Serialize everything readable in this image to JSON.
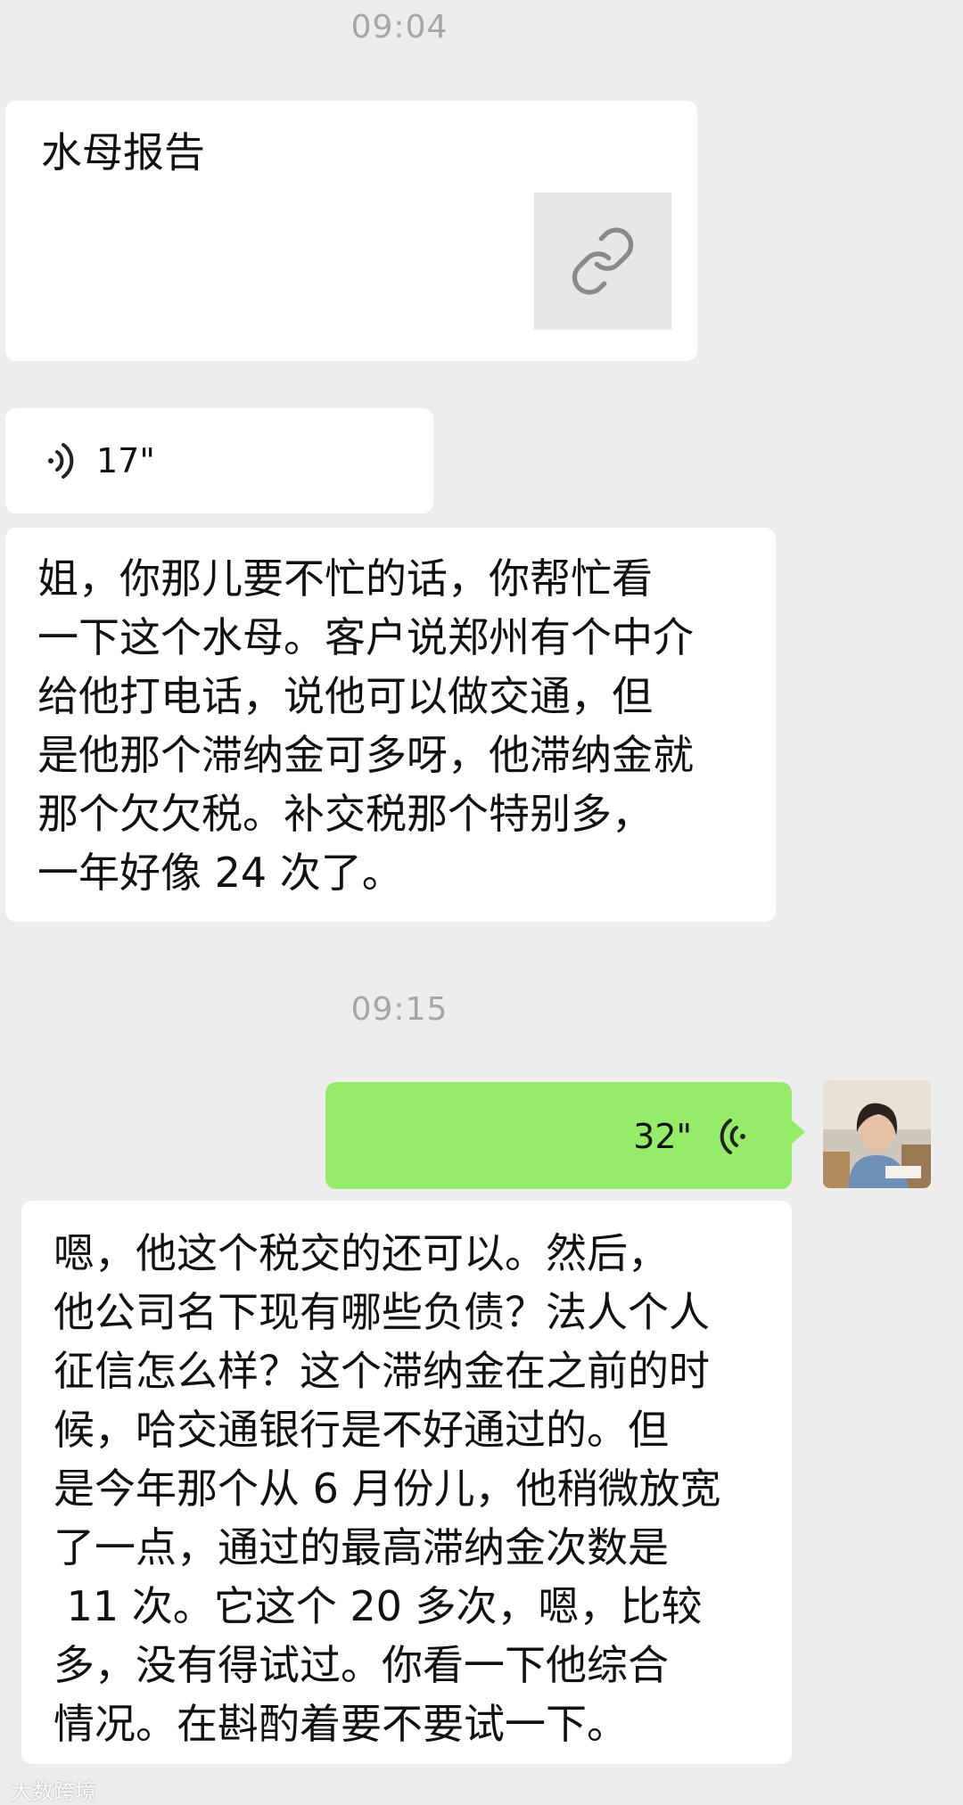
{
  "timestamps": [
    "09:04",
    "09:15"
  ],
  "messages": {
    "link_card": {
      "title": "水母报告",
      "icon": "link-icon"
    },
    "voice_in": {
      "duration": "17\""
    },
    "text_in_1": "姐，你那儿要不忙的话，你帮忙看\n一下这个水母。客户说郑州有个中介\n给他打电话，说他可以做交通，但\n是他那个滞纳金可多呀，他滞纳金就\n那个欠欠税。补交税那个特别多，\n一年好像 24 次了。",
    "voice_out": {
      "duration": "32\""
    },
    "text_in_2": "嗯，他这个税交的还可以。然后，\n他公司名下现有哪些负债？法人个人\n征信怎么样？这个滞纳金在之前的时\n候，哈交通银行是不好通过的。但\n是今年那个从 6 月份儿，他稍微放宽\n了一点，通过的最高滞纳金次数是\n 11 次。它这个 20 多次，嗯，比较\n多，没有得试过。你看一下他综合\n情况。在斟酌着要不要试一下。"
  },
  "watermark": "大数跨境",
  "colors": {
    "background": "#ededed",
    "bubble_in": "#ffffff",
    "bubble_out": "#95ec69",
    "timestamp": "#a6a6a6"
  }
}
